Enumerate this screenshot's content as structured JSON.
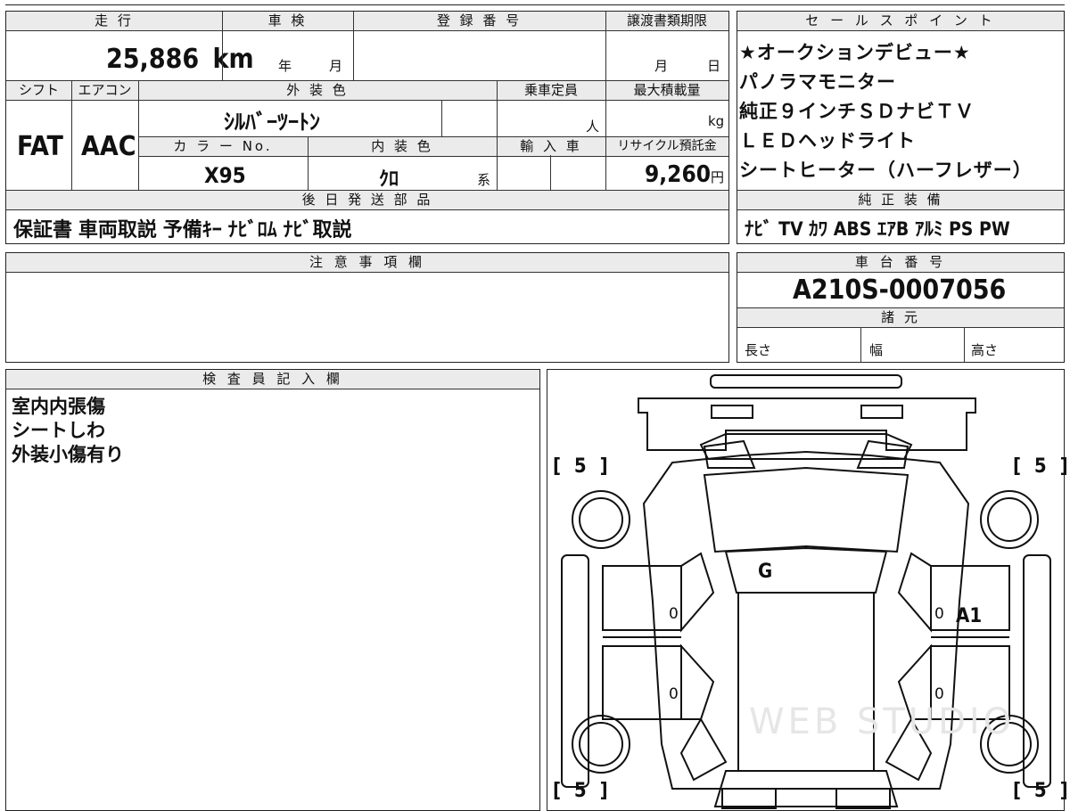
{
  "top": {
    "mileage_label": "走 行",
    "mileage_value": "25,886",
    "mileage_unit": "km",
    "inspection_label": "車 検",
    "year_label": "年",
    "month_label": "月",
    "registration_label": "登 録 番 号",
    "transfer_label": "譲渡書類期限",
    "transfer_month": "月",
    "transfer_day": "日"
  },
  "spec": {
    "shift_label": "シフト",
    "shift_value": "FAT",
    "aircon_label": "エアコン",
    "aircon_value": "AAC",
    "exterior_label": "外 装 色",
    "exterior_value": "ｼﾙﾊﾞｰﾂｰﾄﾝ",
    "capacity_label": "乗車定員",
    "capacity_unit": "人",
    "maxload_label": "最大積載量",
    "maxload_unit": "kg",
    "colorno_label": "カ ラ ー No.",
    "colorno_value": "X95",
    "interior_label": "内 装 色",
    "interior_value": "ｸﾛ",
    "interior_suffix": "系",
    "import_label": "輸 入 車",
    "recycle_label": "リサイクル預託金",
    "recycle_value": "9,260",
    "recycle_unit": "円"
  },
  "shipping": {
    "label": "後 日 発 送 部 品",
    "value": "保証書 車両取説 予備ｷｰ ﾅﾋﾞﾛﾑ ﾅﾋﾞ取説"
  },
  "sales_points": {
    "label": "セ ー ル ス ポ イ ン ト",
    "items": [
      "★オークションデビュー★",
      "パノラマモニター",
      "純正９インチＳＤナビＴＶ",
      "ＬＥＤヘッドライト",
      "シートヒーター（ハーフレザー）"
    ]
  },
  "equipment": {
    "label": "純 正 装 備",
    "value": "ﾅﾋﾞ TV ｶﾜ ABS ｴｱB ｱﾙﾐ PS PW"
  },
  "notes": {
    "label": "注 意 事 項 欄"
  },
  "chassis": {
    "label": "車 台 番 号",
    "value": "A210S-0007056",
    "dims_label": "諸 元",
    "length_label": "長さ",
    "width_label": "幅",
    "height_label": "高さ"
  },
  "inspector": {
    "label": "検 査 員 記 入 欄",
    "items": [
      "室内内張傷",
      "シートしわ",
      "外装小傷有り"
    ]
  },
  "diagram": {
    "tire_front_left": "[ 5 ]",
    "tire_front_right": "[ 5 ]",
    "tire_rear_left": "[ 5 ]",
    "tire_rear_right": "[ 5 ]",
    "mark_windshield": "G",
    "mark_right_door": "A1",
    "door_zero_1": "0",
    "door_zero_2": "0",
    "door_zero_3": "0",
    "door_zero_4": "0",
    "watermark": "WEB STUDIO"
  }
}
